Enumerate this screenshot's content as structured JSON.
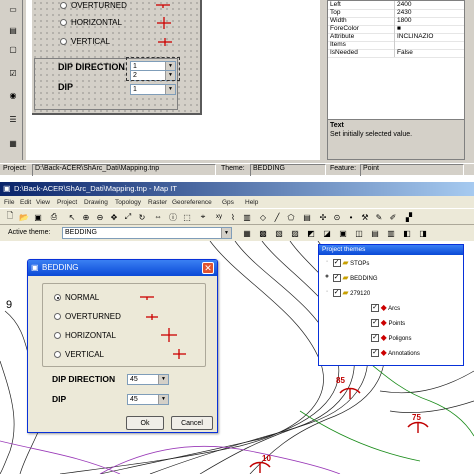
{
  "top_dialog": {
    "options": [
      "OVERTURNED",
      "HORIZONTAL",
      "VERTICAL"
    ],
    "dip_direction_label": "DIP DIRECTION",
    "dip_label": "DIP",
    "dip_value": "1",
    "dip_direction_values": [
      "1",
      "2"
    ]
  },
  "properties": {
    "rows": [
      {
        "key": "Left",
        "value": "2400"
      },
      {
        "key": "Top",
        "value": "2430"
      },
      {
        "key": "Width",
        "value": "1800"
      },
      {
        "key": "ForeColor",
        "value": "■"
      },
      {
        "key": "Attribute",
        "value": "INCLINAZIO"
      },
      {
        "key": "Items",
        "value": ""
      },
      {
        "key": "IsNeeded",
        "value": "False"
      }
    ],
    "description_title": "Text",
    "description_text": "Set initially selected value."
  },
  "status_bar": {
    "project_label": "Project:",
    "project_value": "D:\\Back-ACER\\ShArc_Dati\\Mapping.tnp",
    "theme_label": "Theme:",
    "theme_value": "BEDDING",
    "feature_label": "Feature:",
    "feature_value": "Point"
  },
  "main_window": {
    "title": "D:\\Back-ACER\\ShArc_Dati\\Mapping.tnp - Map IT",
    "menu": [
      "File",
      "Edit",
      "View",
      "Project",
      "Drawing",
      "Topology",
      "Raster",
      "Georeference",
      "Gps",
      "Help"
    ],
    "active_theme_label": "Active theme:",
    "active_theme_value": "BEDDING"
  },
  "bedding_dialog": {
    "title": "BEDDING",
    "options": [
      {
        "label": "NORMAL",
        "selected": true
      },
      {
        "label": "OVERTURNED",
        "selected": false
      },
      {
        "label": "HORIZONTAL",
        "selected": false
      },
      {
        "label": "VERTICAL",
        "selected": false
      }
    ],
    "dip_direction_label": "DIP DIRECTION",
    "dip_direction_value": "45",
    "dip_label": "DIP",
    "dip_value": "45",
    "ok_label": "Ok",
    "cancel_label": "Cancel"
  },
  "project_themes": {
    "title": "Project themes",
    "items": [
      {
        "label": "STOPs",
        "level": 0
      },
      {
        "label": "BEDDING",
        "level": 0
      },
      {
        "label": "279120",
        "level": 0
      },
      {
        "label": "Arcs",
        "level": 1
      },
      {
        "label": "Points",
        "level": 1
      },
      {
        "label": "Poligons",
        "level": 1
      },
      {
        "label": "Annotations",
        "level": 1
      }
    ]
  },
  "map": {
    "labels": [
      "85",
      "75",
      "10"
    ],
    "left_partial": "9"
  },
  "colors": {
    "titlebar": "#0a246a",
    "titlebar_end": "#a6caf0",
    "xp_blue": "#2a5bd7",
    "strike_red": "#cc0000",
    "face": "#d4d0c8"
  }
}
